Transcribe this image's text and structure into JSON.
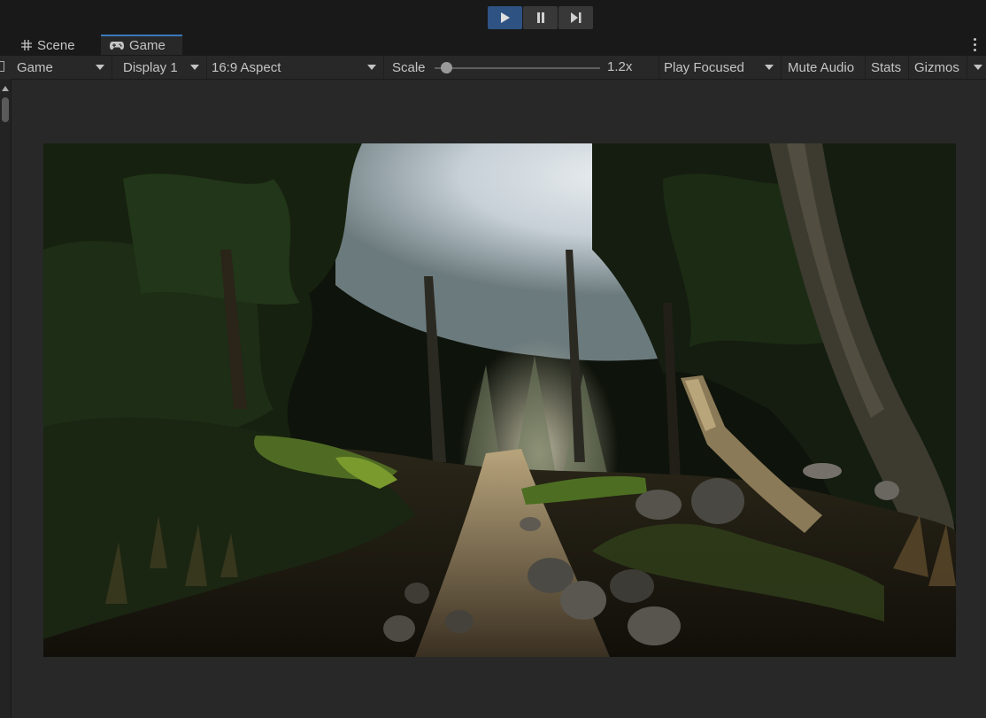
{
  "play_controls": {
    "play_icon": "play-icon",
    "pause_icon": "pause-icon",
    "step_icon": "step-icon",
    "active_color": "#2e5383"
  },
  "tabs": [
    {
      "label": "Scene",
      "icon": "grid-icon",
      "active": false
    },
    {
      "label": "Game",
      "icon": "gamepad-icon",
      "active": true
    }
  ],
  "game_toolbar": {
    "view_mode": "Game",
    "display": "Display 1",
    "aspect": "16:9 Aspect",
    "scale_label": "Scale",
    "scale_value": "1.2x",
    "scale_fraction": 0.07,
    "play_mode": "Play Focused",
    "mute_audio": "Mute Audio",
    "stats": "Stats",
    "gizmos": "Gizmos"
  },
  "colors": {
    "accent": "#3a79bb",
    "background": "#282828",
    "toolbar_dark": "#191919"
  }
}
